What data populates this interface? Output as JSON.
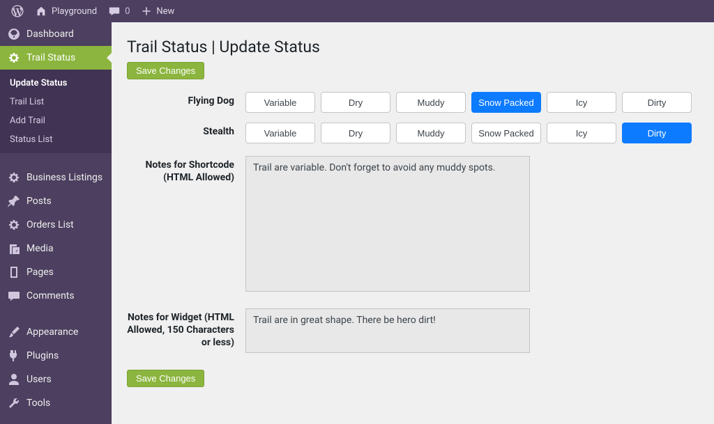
{
  "adminbar": {
    "site": "Playground",
    "comments_count": "0",
    "new_label": "New"
  },
  "sidebar": {
    "items": [
      {
        "label": "Dashboard",
        "icon": "dashboard"
      },
      {
        "label": "Trail Status",
        "icon": "gear"
      },
      {
        "label": "Business Listings",
        "icon": "gear"
      },
      {
        "label": "Posts",
        "icon": "pin"
      },
      {
        "label": "Orders List",
        "icon": "gear"
      },
      {
        "label": "Media",
        "icon": "media"
      },
      {
        "label": "Pages",
        "icon": "pages"
      },
      {
        "label": "Comments",
        "icon": "comment"
      },
      {
        "label": "Appearance",
        "icon": "brush"
      },
      {
        "label": "Plugins",
        "icon": "plug"
      },
      {
        "label": "Users",
        "icon": "user"
      },
      {
        "label": "Tools",
        "icon": "wrench"
      }
    ],
    "submenu": [
      "Update Status",
      "Trail List",
      "Add Trail",
      "Status List"
    ]
  },
  "page": {
    "title": "Trail Status | Update Status",
    "save_label": "Save Changes"
  },
  "trails": [
    {
      "name": "Flying Dog",
      "statuses": [
        "Variable",
        "Dry",
        "Muddy",
        "Snow Packed",
        "Icy",
        "Dirty"
      ],
      "active": "Snow Packed"
    },
    {
      "name": "Stealth",
      "statuses": [
        "Variable",
        "Dry",
        "Muddy",
        "Snow Packed",
        "Icy",
        "Dirty"
      ],
      "active": "Dirty"
    }
  ],
  "notes": {
    "shortcode_label": "Notes for Shortcode (HTML Allowed)",
    "shortcode_value": "Trail are variable. Don't forget to avoid any muddy spots.",
    "widget_label": "Notes for Widget (HTML Allowed, 150 Characters or less)",
    "widget_value": "Trail are in great shape. There be hero dirt!"
  }
}
